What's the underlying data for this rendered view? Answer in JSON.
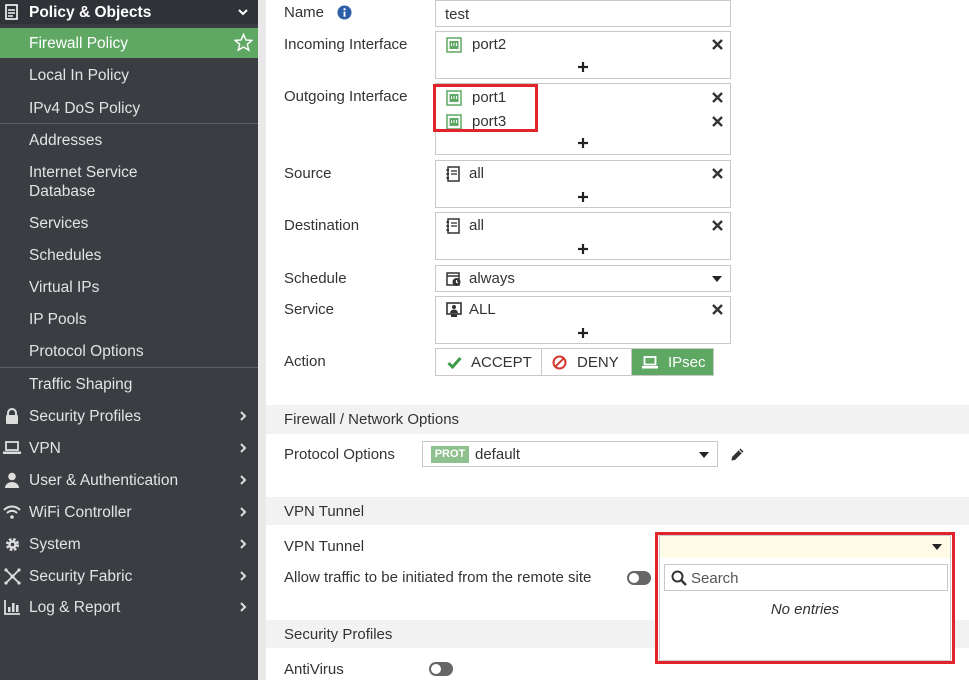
{
  "sidebar": {
    "header": {
      "label": "Policy & Objects",
      "icon": "document-icon"
    },
    "items": [
      {
        "label": "Firewall Policy",
        "active": true
      },
      {
        "label": "Local In Policy"
      },
      {
        "label": "IPv4 DoS Policy"
      },
      {
        "label": "Addresses"
      },
      {
        "label": "Internet Service",
        "label2": "Database"
      },
      {
        "label": "Services"
      },
      {
        "label": "Schedules"
      },
      {
        "label": "Virtual IPs"
      },
      {
        "label": "IP Pools"
      },
      {
        "label": "Protocol Options"
      },
      {
        "label": "Traffic Shaping"
      }
    ],
    "groups": [
      {
        "label": "Security Profiles",
        "icon": "lock-icon"
      },
      {
        "label": "VPN",
        "icon": "laptop-icon"
      },
      {
        "label": "User & Authentication",
        "icon": "user-icon"
      },
      {
        "label": "WiFi Controller",
        "icon": "wifi-icon"
      },
      {
        "label": "System",
        "icon": "gear-icon"
      },
      {
        "label": "Security Fabric",
        "icon": "fabric-icon"
      },
      {
        "label": "Log & Report",
        "icon": "chart-icon"
      }
    ]
  },
  "form": {
    "name_label": "Name",
    "name_value": "test",
    "incoming_label": "Incoming Interface",
    "incoming": [
      "port2"
    ],
    "outgoing_label": "Outgoing Interface",
    "outgoing": [
      "port1",
      "port3"
    ],
    "source_label": "Source",
    "source": [
      "all"
    ],
    "destination_label": "Destination",
    "destination": [
      "all"
    ],
    "schedule_label": "Schedule",
    "schedule_value": "always",
    "service_label": "Service",
    "service": [
      "ALL"
    ],
    "action_label": "Action",
    "actions": [
      "ACCEPT",
      "DENY",
      "IPsec"
    ],
    "action_selected": "IPsec"
  },
  "firewall_options": {
    "section_title": "Firewall / Network Options",
    "protocol_label": "Protocol Options",
    "protocol_badge": "PROT",
    "protocol_value": "default"
  },
  "vpn": {
    "section_title": "VPN Tunnel",
    "tunnel_label": "VPN Tunnel",
    "allow_label": "Allow traffic to be initiated from the remote site",
    "search_placeholder": "Search",
    "no_entries": "No entries"
  },
  "security_profiles": {
    "section_title": "Security Profiles",
    "antivirus_label": "AntiVirus"
  },
  "colors": {
    "accent": "#5fa863",
    "sidebar": "#3a3d41",
    "highlight": "#e2232b"
  }
}
